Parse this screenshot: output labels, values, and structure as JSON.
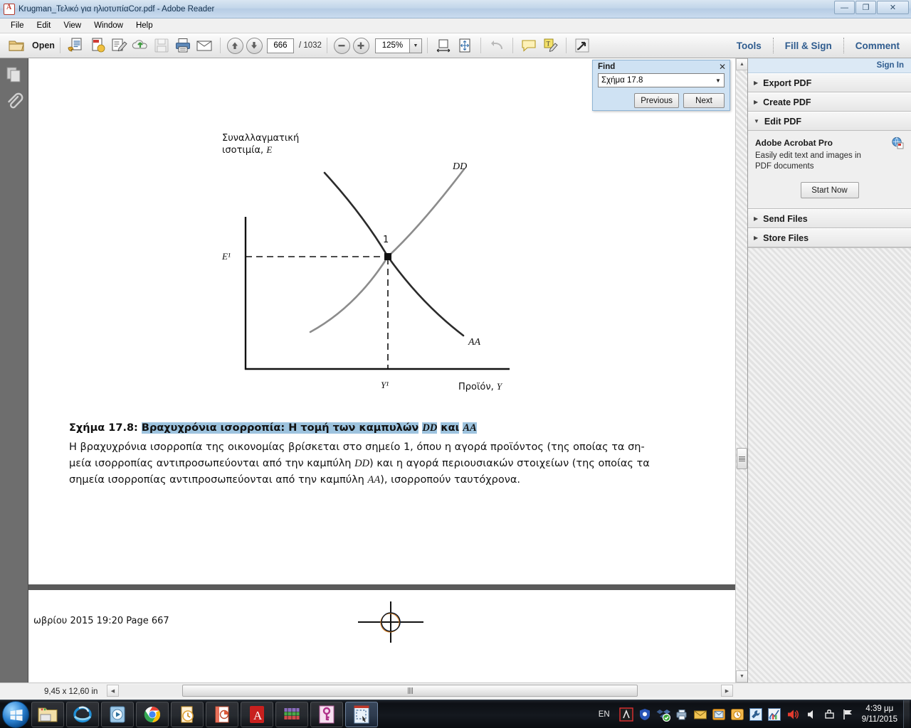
{
  "window": {
    "title": "Krugman_Τελικό για ηλιοτυπίαCor.pdf - Adobe Reader",
    "app_icon": "adobe-reader-icon",
    "minimize_glyph": "—",
    "restore_glyph": "❐",
    "close_glyph": "✕"
  },
  "menu": {
    "items": [
      {
        "label": "File"
      },
      {
        "label": "Edit"
      },
      {
        "label": "View"
      },
      {
        "label": "Window"
      },
      {
        "label": "Help"
      }
    ]
  },
  "toolbar": {
    "open_label": "Open",
    "open_icon": "folder-open-icon",
    "icons": [
      {
        "name": "save-as-pdf-icon"
      },
      {
        "name": "create-pdf-icon"
      },
      {
        "name": "edit-pdf-icon"
      },
      {
        "name": "cloud-upload-icon"
      },
      {
        "name": "save-icon"
      },
      {
        "name": "print-icon"
      },
      {
        "name": "email-icon"
      }
    ],
    "prev_page_icon": "arrow-up-icon",
    "next_page_icon": "arrow-down-icon",
    "page_number": "666",
    "page_total": "/ 1032",
    "zoom_out_icon": "minus-circle-icon",
    "zoom_in_icon": "plus-circle-icon",
    "zoom_level": "125%",
    "zoom_caret": "▼",
    "right_icons": [
      {
        "name": "fit-width-icon"
      },
      {
        "name": "fit-page-icon"
      },
      {
        "name": "undo-icon"
      },
      {
        "name": "sticky-note-icon"
      },
      {
        "name": "highlight-text-icon"
      },
      {
        "name": "read-mode-icon"
      }
    ],
    "links": [
      {
        "label": "Tools"
      },
      {
        "label": "Fill & Sign"
      },
      {
        "label": "Comment"
      }
    ]
  },
  "nav_pane": {
    "items": [
      {
        "name": "page-thumbnails-icon"
      },
      {
        "name": "attachments-icon"
      }
    ]
  },
  "find_dialog": {
    "title": "Find",
    "close_glyph": "✕",
    "query": "Σχήμα 17.8",
    "dropdown_caret": "▼",
    "previous_label": "Previous",
    "next_label": "Next"
  },
  "task_pane": {
    "sign_in_label": "Sign In",
    "sections": [
      {
        "label": "Export PDF",
        "expanded": false,
        "triangle": "▶"
      },
      {
        "label": "Create PDF",
        "expanded": false,
        "triangle": "▶"
      },
      {
        "label": "Edit PDF",
        "expanded": true,
        "triangle": "▼"
      },
      {
        "label": "Send Files",
        "expanded": false,
        "triangle": "▶"
      },
      {
        "label": "Store Files",
        "expanded": false,
        "triangle": "▶"
      }
    ],
    "edit_pdf_panel": {
      "product": "Adobe Acrobat Pro",
      "description": "Easily edit text and images in PDF documents",
      "button_label": "Start Now",
      "product_icon": "acrobat-pro-icon"
    }
  },
  "document": {
    "caption": {
      "label_prefix": "Σχήμα 17.8:",
      "title_part1": "Βραχυχρόνια ισορροπία: Η τομή των καμπυλών",
      "title_dd": "DD",
      "title_kai": "και",
      "title_aa": "AA",
      "body_line1": "Η βραχυχρόνια ισορροπία της οικονομίας βρίσκεται στο σημείο 1, όπου η αγορά προϊόντος (της οποίας τα ση-",
      "body_line2_a": "μεία ισορροπίας αντιπροσωπεύονται από την καμπύλη ",
      "body_line2_dd": "DD",
      "body_line2_b": ") και η αγορά περιουσιακών στοιχείων (της οποίας τα",
      "body_line3_a": "σημεία ισορροπίας αντιπροσωπεύονται από την καμπύλη ",
      "body_line3_aa": "AA",
      "body_line3_b": "), ισορροπούν ταυτόχρονα."
    },
    "footer_text": "ωβρίου 2015  19:20  Page 667",
    "highlight_color": "#9dc3de",
    "registration_mark_icon": "registration-crosshair-icon"
  },
  "chart_data": {
    "type": "line",
    "title": "",
    "xlabel": "Προϊόν, Y",
    "ylabel": "Συναλλαγματική ισοτιμία, E",
    "ylabel_line1": "Συναλλαγματική",
    "ylabel_line2": "ισοτιμία,",
    "ylabel_symbol": "E",
    "xlabel_text": "Προϊόν,",
    "xlabel_symbol": "Y",
    "grid": false,
    "legend": "inline-curve-labels",
    "series": [
      {
        "name": "DD",
        "label": "DD",
        "color": "#8c8c8c",
        "description": "upward-sloping output-market equilibrium curve",
        "points": [
          [
            0.22,
            0.18
          ],
          [
            0.55,
            0.52
          ],
          [
            0.78,
            0.78
          ],
          [
            0.89,
            0.92
          ]
        ]
      },
      {
        "name": "AA",
        "label": "AA",
        "color": "#2b2b2b",
        "description": "downward-sloping asset-market equilibrium curve",
        "points": [
          [
            0.25,
            0.92
          ],
          [
            0.43,
            0.74
          ],
          [
            0.55,
            0.52
          ],
          [
            0.84,
            0.18
          ]
        ]
      }
    ],
    "annotations": [
      {
        "name": "equilibrium-point",
        "label": "1",
        "x": 0.55,
        "y": 0.52
      },
      {
        "name": "y-tick",
        "label": "E¹",
        "axis": "y",
        "value": 0.52
      },
      {
        "name": "x-tick",
        "label": "Y¹",
        "axis": "x",
        "value": 0.55
      }
    ],
    "dashed_guides": [
      {
        "from": "y-axis",
        "to": "equilibrium-point"
      },
      {
        "from": "x-axis",
        "to": "equilibrium-point"
      }
    ]
  },
  "status_bar": {
    "page_size": "9,45 x 12,60 in",
    "h_scroll_left_glyph": "◀",
    "h_scroll_right_glyph": "▶"
  },
  "taskbar": {
    "start_icon": "windows-start-orb-icon",
    "items": [
      {
        "name": "file-explorer-icon",
        "active": false
      },
      {
        "name": "internet-explorer-icon",
        "active": false
      },
      {
        "name": "windows-media-player-icon",
        "active": false
      },
      {
        "name": "google-chrome-icon",
        "active": false
      },
      {
        "name": "microsoft-outlook-icon",
        "active": false
      },
      {
        "name": "microsoft-powerpoint-icon",
        "active": false
      },
      {
        "name": "adobe-reader-icon",
        "active": false
      },
      {
        "name": "winrar-icon",
        "active": false
      },
      {
        "name": "keygen-app-icon",
        "active": false
      },
      {
        "name": "snipping-tool-icon",
        "active": true
      }
    ],
    "tray": {
      "language": "EN",
      "icons": [
        {
          "name": "adobe-tray-icon"
        },
        {
          "name": "antivirus-shield-icon"
        },
        {
          "name": "dropbox-sync-icon"
        },
        {
          "name": "network-printer-icon"
        },
        {
          "name": "mail-tray-icon"
        },
        {
          "name": "messenger-icon"
        },
        {
          "name": "outlook-tray-icon"
        },
        {
          "name": "settings-wrench-icon"
        },
        {
          "name": "graph-tray-icon"
        },
        {
          "name": "volume-speaker-icon"
        },
        {
          "name": "sound-level-icon"
        },
        {
          "name": "network-icon"
        },
        {
          "name": "action-center-flag-icon"
        }
      ],
      "time": "4:39 μμ",
      "date": "9/11/2015"
    }
  }
}
